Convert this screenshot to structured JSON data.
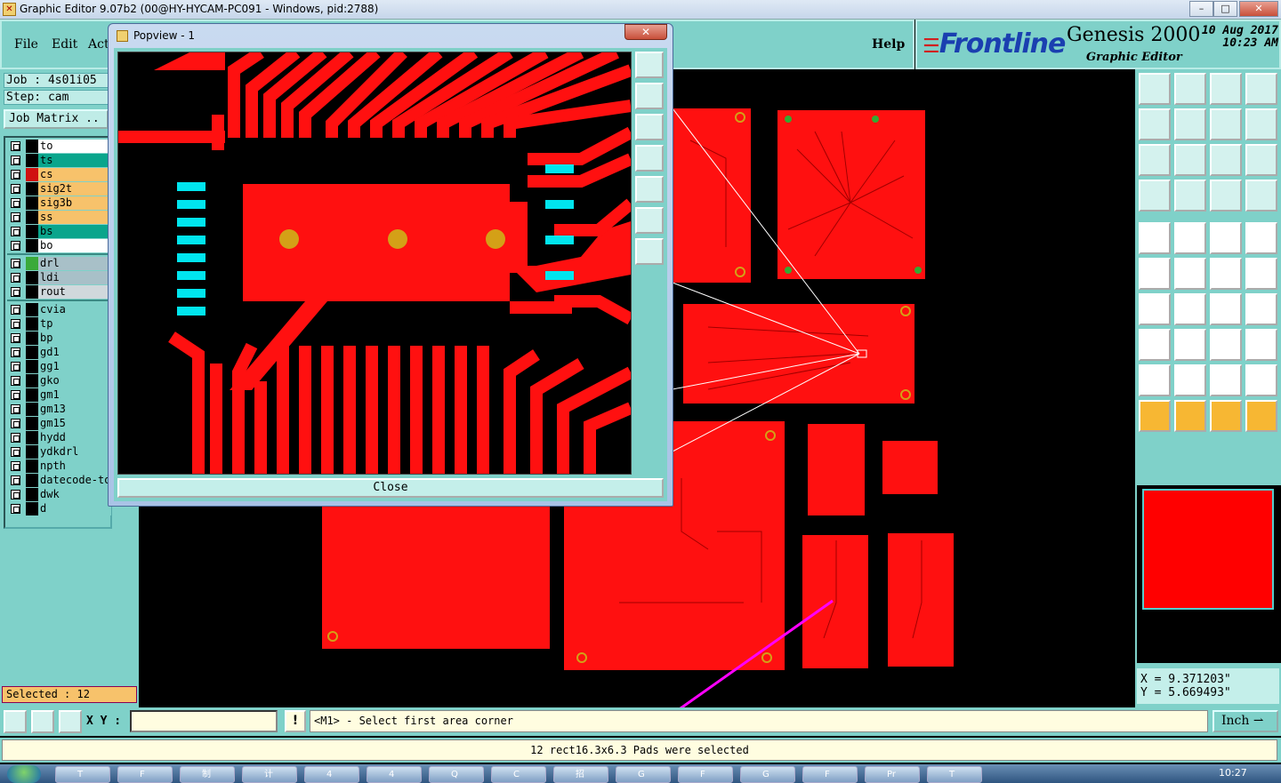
{
  "window": {
    "title": "Graphic Editor 9.07b2 (00@HY-HYCAM-PC091 - Windows, pid:2788)",
    "controls": [
      "–",
      "□",
      "✕"
    ]
  },
  "menu": {
    "items": [
      "File",
      "Edit",
      "Act"
    ],
    "help": "Help"
  },
  "brand": {
    "logo_bars": "☰",
    "logo": "Frontline",
    "product": "Genesis 2000",
    "subtitle": "Graphic Editor",
    "date": "10 Aug 2017",
    "time": "10:23 AM"
  },
  "left": {
    "job": "Job : 4s01i05",
    "step": "Step: cam",
    "job_matrix": "Job Matrix ..",
    "selected": "Selected : 12"
  },
  "layers": [
    {
      "name": "to",
      "bg": "#ffffff",
      "sw": "#000000"
    },
    {
      "name": "ts",
      "bg": "#0aa58c",
      "sw": "#000000"
    },
    {
      "name": "cs",
      "bg": "#f7c26b",
      "sw": "#d01010"
    },
    {
      "name": "sig2t",
      "bg": "#f7c26b",
      "sw": "#000000"
    },
    {
      "name": "sig3b",
      "bg": "#f7c26b",
      "sw": "#000000"
    },
    {
      "name": "ss",
      "bg": "#f7c26b",
      "sw": "#000000"
    },
    {
      "name": "bs",
      "bg": "#0aa58c",
      "sw": "#000000"
    },
    {
      "name": "bo",
      "bg": "#ffffff",
      "sw": "#000000"
    },
    {
      "name": "drl",
      "bg": "#a8c0c8",
      "sw": "#3aaa3a"
    },
    {
      "name": "ldi",
      "bg": "#a8c0c8",
      "sw": "#000000"
    },
    {
      "name": "rout",
      "bg": "#d0d8dc",
      "sw": "#000000"
    },
    {
      "name": "cvia",
      "bg": "#7fd1c9",
      "sw": "#000000"
    },
    {
      "name": "tp",
      "bg": "#7fd1c9",
      "sw": "#000000"
    },
    {
      "name": "bp",
      "bg": "#7fd1c9",
      "sw": "#000000"
    },
    {
      "name": "gd1",
      "bg": "#7fd1c9",
      "sw": "#000000"
    },
    {
      "name": "gg1",
      "bg": "#7fd1c9",
      "sw": "#000000"
    },
    {
      "name": "gko",
      "bg": "#7fd1c9",
      "sw": "#000000"
    },
    {
      "name": "gm1",
      "bg": "#7fd1c9",
      "sw": "#000000"
    },
    {
      "name": "gm13",
      "bg": "#7fd1c9",
      "sw": "#000000"
    },
    {
      "name": "gm15",
      "bg": "#7fd1c9",
      "sw": "#000000"
    },
    {
      "name": "hydd",
      "bg": "#7fd1c9",
      "sw": "#000000"
    },
    {
      "name": "ydkdrl",
      "bg": "#7fd1c9",
      "sw": "#000000"
    },
    {
      "name": "npth",
      "bg": "#7fd1c9",
      "sw": "#000000"
    },
    {
      "name": "datecode-to",
      "bg": "#7fd1c9",
      "sw": "#000000"
    },
    {
      "name": "dwk",
      "bg": "#7fd1c9",
      "sw": "#000000"
    },
    {
      "name": "d",
      "bg": "#7fd1c9",
      "sw": "#000000"
    }
  ],
  "popview": {
    "title": "Popview - 1",
    "close_x": "✕",
    "close_button": "Close"
  },
  "coords": {
    "x": "X = 9.371203\"",
    "y": "Y = 5.669493\""
  },
  "command": {
    "xy_label": "X Y :",
    "xy_value": "",
    "bang": "!",
    "prompt": "<M1> - Select first area corner",
    "unit": "Inch ⇀"
  },
  "status": {
    "message": "12 rect16.3x6.3 Pads were selected"
  },
  "taskbar": {
    "clock": "10:27",
    "tasks": [
      "T",
      "F",
      "制",
      "计",
      "4",
      "4",
      "Q",
      "C",
      "招",
      "G",
      "F",
      "G",
      "F",
      "Pr",
      "T"
    ]
  },
  "colors": {
    "copper": "#ff0000",
    "pad": "#00e5ee",
    "drill": "#d4a017",
    "panel": "#7fd1c9",
    "annotation_arrow": "#ff00ff"
  }
}
